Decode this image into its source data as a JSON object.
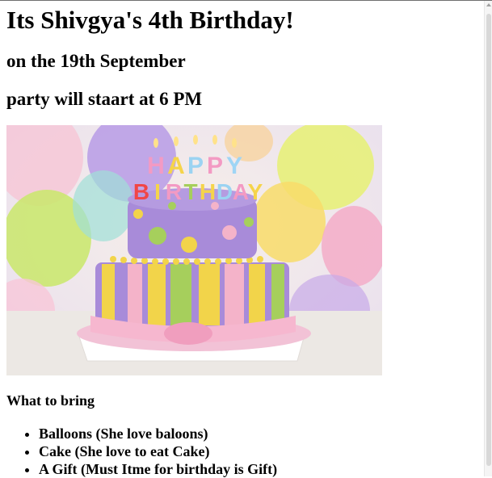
{
  "title": "Its Shivgya's 4th Birthday!",
  "date_line": "on the 19th September",
  "time_line": "party will staart at 6 PM",
  "cake_letters": {
    "top": [
      "H",
      "A",
      "P",
      "P",
      "Y"
    ],
    "bottom": [
      "B",
      "I",
      "R",
      "T",
      "H",
      "D",
      "A",
      "Y"
    ]
  },
  "bring_heading": "What to bring",
  "bring_items": [
    "Balloons (She love baloons)",
    "Cake (She love to eat Cake)",
    "A Gift (Must Itme for birthday is Gift)"
  ],
  "colors": {
    "cake_purple": "#a88bd9",
    "cake_yellow": "#f2d44a",
    "cake_green": "#a6cf5c",
    "cake_pink": "#f4b3c9"
  }
}
